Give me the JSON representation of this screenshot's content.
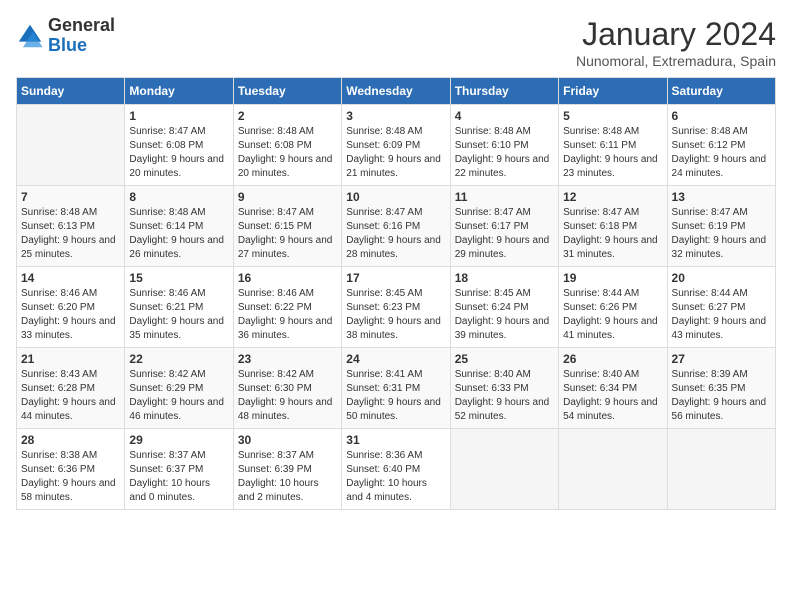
{
  "header": {
    "logo_general": "General",
    "logo_blue": "Blue",
    "month_title": "January 2024",
    "subtitle": "Nunomoral, Extremadura, Spain"
  },
  "weekdays": [
    "Sunday",
    "Monday",
    "Tuesday",
    "Wednesday",
    "Thursday",
    "Friday",
    "Saturday"
  ],
  "weeks": [
    [
      {
        "day": "",
        "sunrise": "",
        "sunset": "",
        "daylight": ""
      },
      {
        "day": "1",
        "sunrise": "Sunrise: 8:47 AM",
        "sunset": "Sunset: 6:08 PM",
        "daylight": "Daylight: 9 hours and 20 minutes."
      },
      {
        "day": "2",
        "sunrise": "Sunrise: 8:48 AM",
        "sunset": "Sunset: 6:08 PM",
        "daylight": "Daylight: 9 hours and 20 minutes."
      },
      {
        "day": "3",
        "sunrise": "Sunrise: 8:48 AM",
        "sunset": "Sunset: 6:09 PM",
        "daylight": "Daylight: 9 hours and 21 minutes."
      },
      {
        "day": "4",
        "sunrise": "Sunrise: 8:48 AM",
        "sunset": "Sunset: 6:10 PM",
        "daylight": "Daylight: 9 hours and 22 minutes."
      },
      {
        "day": "5",
        "sunrise": "Sunrise: 8:48 AM",
        "sunset": "Sunset: 6:11 PM",
        "daylight": "Daylight: 9 hours and 23 minutes."
      },
      {
        "day": "6",
        "sunrise": "Sunrise: 8:48 AM",
        "sunset": "Sunset: 6:12 PM",
        "daylight": "Daylight: 9 hours and 24 minutes."
      }
    ],
    [
      {
        "day": "7",
        "sunrise": "Sunrise: 8:48 AM",
        "sunset": "Sunset: 6:13 PM",
        "daylight": "Daylight: 9 hours and 25 minutes."
      },
      {
        "day": "8",
        "sunrise": "Sunrise: 8:48 AM",
        "sunset": "Sunset: 6:14 PM",
        "daylight": "Daylight: 9 hours and 26 minutes."
      },
      {
        "day": "9",
        "sunrise": "Sunrise: 8:47 AM",
        "sunset": "Sunset: 6:15 PM",
        "daylight": "Daylight: 9 hours and 27 minutes."
      },
      {
        "day": "10",
        "sunrise": "Sunrise: 8:47 AM",
        "sunset": "Sunset: 6:16 PM",
        "daylight": "Daylight: 9 hours and 28 minutes."
      },
      {
        "day": "11",
        "sunrise": "Sunrise: 8:47 AM",
        "sunset": "Sunset: 6:17 PM",
        "daylight": "Daylight: 9 hours and 29 minutes."
      },
      {
        "day": "12",
        "sunrise": "Sunrise: 8:47 AM",
        "sunset": "Sunset: 6:18 PM",
        "daylight": "Daylight: 9 hours and 31 minutes."
      },
      {
        "day": "13",
        "sunrise": "Sunrise: 8:47 AM",
        "sunset": "Sunset: 6:19 PM",
        "daylight": "Daylight: 9 hours and 32 minutes."
      }
    ],
    [
      {
        "day": "14",
        "sunrise": "Sunrise: 8:46 AM",
        "sunset": "Sunset: 6:20 PM",
        "daylight": "Daylight: 9 hours and 33 minutes."
      },
      {
        "day": "15",
        "sunrise": "Sunrise: 8:46 AM",
        "sunset": "Sunset: 6:21 PM",
        "daylight": "Daylight: 9 hours and 35 minutes."
      },
      {
        "day": "16",
        "sunrise": "Sunrise: 8:46 AM",
        "sunset": "Sunset: 6:22 PM",
        "daylight": "Daylight: 9 hours and 36 minutes."
      },
      {
        "day": "17",
        "sunrise": "Sunrise: 8:45 AM",
        "sunset": "Sunset: 6:23 PM",
        "daylight": "Daylight: 9 hours and 38 minutes."
      },
      {
        "day": "18",
        "sunrise": "Sunrise: 8:45 AM",
        "sunset": "Sunset: 6:24 PM",
        "daylight": "Daylight: 9 hours and 39 minutes."
      },
      {
        "day": "19",
        "sunrise": "Sunrise: 8:44 AM",
        "sunset": "Sunset: 6:26 PM",
        "daylight": "Daylight: 9 hours and 41 minutes."
      },
      {
        "day": "20",
        "sunrise": "Sunrise: 8:44 AM",
        "sunset": "Sunset: 6:27 PM",
        "daylight": "Daylight: 9 hours and 43 minutes."
      }
    ],
    [
      {
        "day": "21",
        "sunrise": "Sunrise: 8:43 AM",
        "sunset": "Sunset: 6:28 PM",
        "daylight": "Daylight: 9 hours and 44 minutes."
      },
      {
        "day": "22",
        "sunrise": "Sunrise: 8:42 AM",
        "sunset": "Sunset: 6:29 PM",
        "daylight": "Daylight: 9 hours and 46 minutes."
      },
      {
        "day": "23",
        "sunrise": "Sunrise: 8:42 AM",
        "sunset": "Sunset: 6:30 PM",
        "daylight": "Daylight: 9 hours and 48 minutes."
      },
      {
        "day": "24",
        "sunrise": "Sunrise: 8:41 AM",
        "sunset": "Sunset: 6:31 PM",
        "daylight": "Daylight: 9 hours and 50 minutes."
      },
      {
        "day": "25",
        "sunrise": "Sunrise: 8:40 AM",
        "sunset": "Sunset: 6:33 PM",
        "daylight": "Daylight: 9 hours and 52 minutes."
      },
      {
        "day": "26",
        "sunrise": "Sunrise: 8:40 AM",
        "sunset": "Sunset: 6:34 PM",
        "daylight": "Daylight: 9 hours and 54 minutes."
      },
      {
        "day": "27",
        "sunrise": "Sunrise: 8:39 AM",
        "sunset": "Sunset: 6:35 PM",
        "daylight": "Daylight: 9 hours and 56 minutes."
      }
    ],
    [
      {
        "day": "28",
        "sunrise": "Sunrise: 8:38 AM",
        "sunset": "Sunset: 6:36 PM",
        "daylight": "Daylight: 9 hours and 58 minutes."
      },
      {
        "day": "29",
        "sunrise": "Sunrise: 8:37 AM",
        "sunset": "Sunset: 6:37 PM",
        "daylight": "Daylight: 10 hours and 0 minutes."
      },
      {
        "day": "30",
        "sunrise": "Sunrise: 8:37 AM",
        "sunset": "Sunset: 6:39 PM",
        "daylight": "Daylight: 10 hours and 2 minutes."
      },
      {
        "day": "31",
        "sunrise": "Sunrise: 8:36 AM",
        "sunset": "Sunset: 6:40 PM",
        "daylight": "Daylight: 10 hours and 4 minutes."
      },
      {
        "day": "",
        "sunrise": "",
        "sunset": "",
        "daylight": ""
      },
      {
        "day": "",
        "sunrise": "",
        "sunset": "",
        "daylight": ""
      },
      {
        "day": "",
        "sunrise": "",
        "sunset": "",
        "daylight": ""
      }
    ]
  ]
}
